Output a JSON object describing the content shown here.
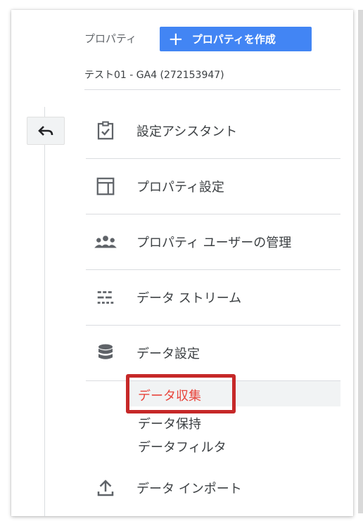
{
  "header": {
    "property_label": "プロパティ",
    "create_button_icon": "plus-icon",
    "create_button_label": "プロパティを作成",
    "property_name": "テスト01 - GA4 (272153947)"
  },
  "nav": {
    "back_icon": "back-arrow-icon",
    "items": [
      {
        "label": "設定アシスタント",
        "icon": "clipboard-check-icon"
      },
      {
        "label": "プロパティ設定",
        "icon": "layout-icon"
      },
      {
        "label": "プロパティ ユーザーの管理",
        "icon": "people-icon"
      },
      {
        "label": "データ ストリーム",
        "icon": "streams-icon"
      },
      {
        "label": "データ設定",
        "icon": "database-icon"
      },
      {
        "label": "データ インポート",
        "icon": "upload-icon"
      }
    ],
    "data_settings_subitems": [
      {
        "label": "データ収集",
        "active": true
      },
      {
        "label": "データ保持",
        "active": false
      },
      {
        "label": "データフィルタ",
        "active": false
      }
    ]
  },
  "colors": {
    "primary_button": "#4285f4",
    "active_subitem": "#e8453c",
    "highlight_border": "#c62828"
  }
}
